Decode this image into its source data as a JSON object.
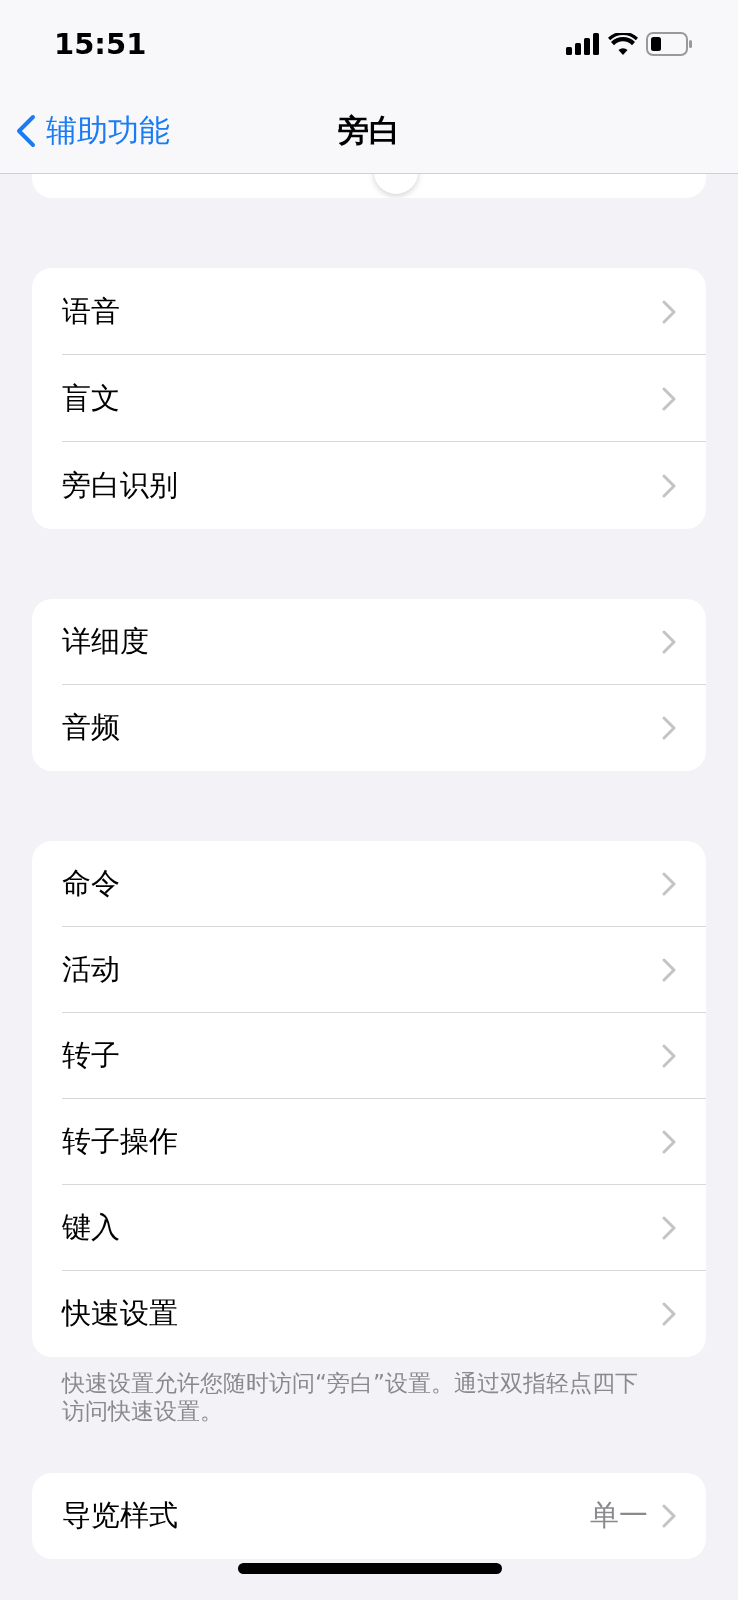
{
  "status_bar": {
    "time": "15:51"
  },
  "nav_bar": {
    "back_label": "辅助功能",
    "title": "旁白"
  },
  "speech_rate_slider": {
    "level": 0.55
  },
  "groups": [
    {
      "rows": [
        {
          "label": "语音"
        },
        {
          "label": "盲文"
        },
        {
          "label": "旁白识别"
        }
      ]
    },
    {
      "rows": [
        {
          "label": "详细度"
        },
        {
          "label": "音频"
        }
      ]
    },
    {
      "rows": [
        {
          "label": "命令"
        },
        {
          "label": "活动"
        },
        {
          "label": "转子"
        },
        {
          "label": "转子操作"
        },
        {
          "label": "键入"
        },
        {
          "label": "快速设置"
        }
      ],
      "footer": "快速设置允许您随时访问“旁白”设置。通过双指轻点四下访问快速设置。"
    },
    {
      "rows": [
        {
          "label": "导览样式",
          "value": "单一"
        }
      ]
    }
  ]
}
